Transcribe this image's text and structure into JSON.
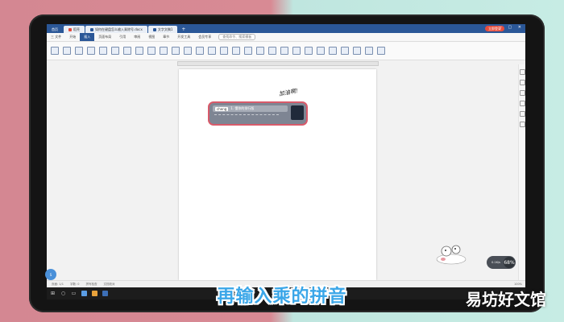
{
  "title_bar": {
    "tabs": [
      {
        "label": "首页",
        "type": "home"
      },
      {
        "label": "稻壳",
        "color": "#e34b3b"
      },
      {
        "label": "如何在键盘怎么输入乘除号.docx",
        "color": "#2b5797"
      },
      {
        "label": "文字文稿1",
        "color": "#2b5797"
      }
    ],
    "add_tab": "+",
    "login_label": "立即登录"
  },
  "menu": {
    "items": [
      "三 文件",
      "开始",
      "插入",
      "页面布局",
      "引用",
      "审阅",
      "视图",
      "章节",
      "开发工具",
      "会员专享"
    ],
    "active_index": 2,
    "search_placeholder": "查找命令、搜索模板"
  },
  "ime": {
    "pinyin": "cheng",
    "candidate": "1. 懂你的排行版",
    "handwriting": "加油啊!"
  },
  "status": {
    "page": "页面: 1/1",
    "words": "字数: 0",
    "spell": "拼写检查",
    "doc_check": "文档校对",
    "zoom": "100%"
  },
  "widget": {
    "percent": "68%",
    "speed": "0.1K/s"
  },
  "bubble": "S",
  "subtitle": "再输入乘的拼音",
  "watermark": "易坊好文馆",
  "colors": {
    "accent": "#2b5797",
    "subtitle": "#3aa6e8",
    "highlight": "#d85a6a"
  }
}
